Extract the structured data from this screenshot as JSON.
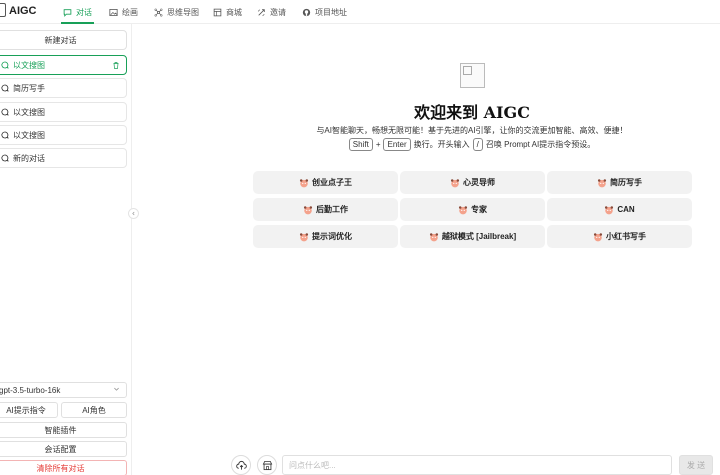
{
  "header": {
    "app_title": "AIGC",
    "tabs": [
      {
        "label": "对话",
        "icon": "chat-icon",
        "active": true
      },
      {
        "label": "绘画",
        "icon": "image-icon",
        "active": false
      },
      {
        "label": "思维导图",
        "icon": "mindmap-icon",
        "active": false
      },
      {
        "label": "商城",
        "icon": "store-icon",
        "active": false
      },
      {
        "label": "邀请",
        "icon": "invite-icon",
        "active": false
      },
      {
        "label": "项目地址",
        "icon": "github-icon",
        "active": false
      }
    ]
  },
  "sidebar": {
    "new_chat_label": "新建对话",
    "conversations": [
      {
        "label": "以文搜图",
        "active": true
      },
      {
        "label": "简历写手",
        "active": false
      },
      {
        "label": "以文搜图",
        "active": false
      },
      {
        "label": "以文搜图",
        "active": false
      },
      {
        "label": "新的对话",
        "active": false
      }
    ],
    "model": "gpt-3.5-turbo-16k",
    "ai_prompt_label": "AI提示指令",
    "ai_role_label": "AI角色",
    "plugins_label": "智能插件",
    "config_label": "会话配置",
    "clear_label": "清除所有对话"
  },
  "main": {
    "welcome_title": "欢迎来到 AIGC",
    "subtitle": "与AI智能聊天，畅想无限可能！基于先进的AI引擎，让你的交流更加智能、高效、便捷！",
    "hint": {
      "key1": "Shift",
      "plus": "+",
      "key2": "Enter",
      "text1": "换行。开头输入",
      "key3": "/",
      "text2": "召唤 Prompt AI提示指令预设。"
    },
    "prompt_cards": [
      "创业点子王",
      "心灵导师",
      "简历写手",
      "后勤工作",
      "专家",
      "CAN",
      "提示词优化",
      "越狱模式 [Jailbreak]",
      "小红书写手"
    ]
  },
  "input": {
    "placeholder": "问点什么吧...",
    "send_label": "发 送"
  },
  "colors": {
    "accent": "#18a058",
    "danger": "#e53935",
    "card_bg": "#f2f2f2"
  }
}
